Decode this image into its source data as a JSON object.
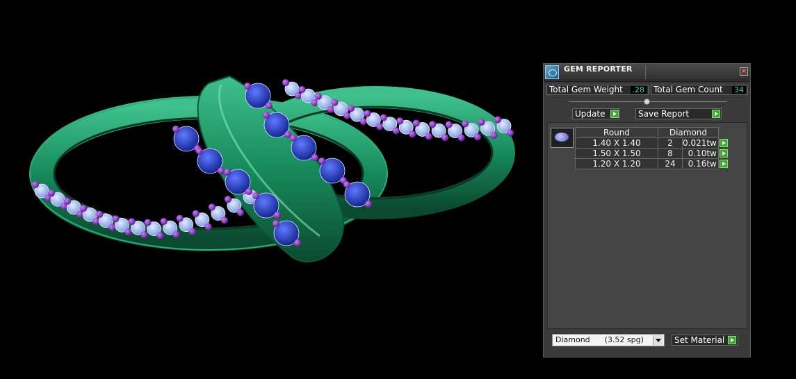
{
  "panel": {
    "title": "GEM REPORTER",
    "close_glyph": "×",
    "total_gem_weight_label": "Total Gem Weight",
    "total_gem_weight_value": ".28",
    "total_gem_count_label": "Total Gem Count",
    "total_gem_count_value": "34",
    "update_label": "Update",
    "save_report_label": "Save Report",
    "set_material_label": "Set Material",
    "material_selected": "Diamond      (3.52 spg)"
  },
  "gem_table": {
    "headers": [
      "Round",
      "Diamond"
    ],
    "rows": [
      {
        "size": "1.40 X 1.40",
        "count": "2",
        "weight": "0.021tw"
      },
      {
        "size": "1.50 X 1.50",
        "count": "8",
        "weight": "0.10tw"
      },
      {
        "size": "1.20 X 1.20",
        "count": "24",
        "weight": "0.16tw"
      }
    ]
  },
  "icons": {
    "app": "gem-reporter-app-icon",
    "close": "close-icon",
    "go": "green-arrow-icon",
    "gem_preview": "round-gem-icon",
    "dropdown": "chevron-down-icon"
  },
  "colors": {
    "background": "#000000",
    "ring_metal": "#1f9a68",
    "sapphire": "#2a3fd6",
    "light_stone": "#a8c4f4",
    "prong": "#9a3fd0",
    "value_text": "#3ed3b8",
    "go_button": "#3aa832"
  }
}
